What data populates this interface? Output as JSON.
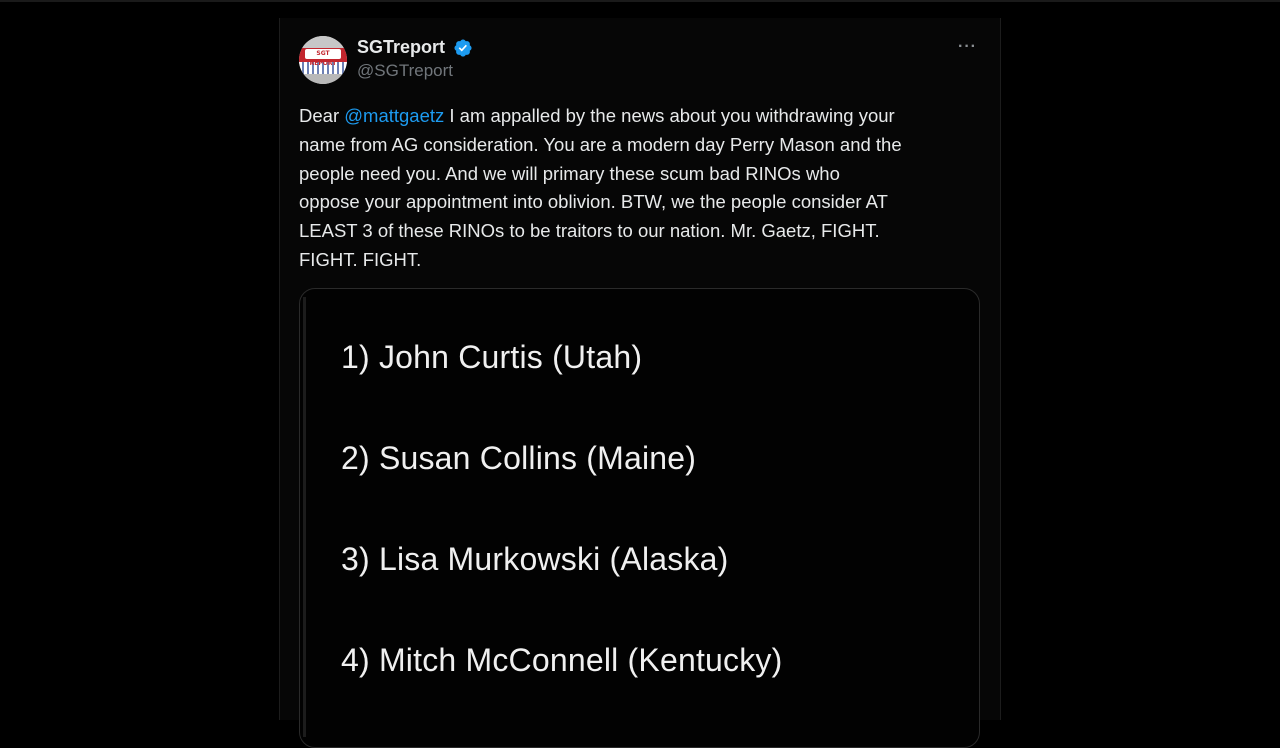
{
  "tweet": {
    "display_name": "SGTreport",
    "handle": "@SGTreport",
    "avatar_text": "SGT REPORT",
    "more_label": "···",
    "body": {
      "greeting": "Dear ",
      "mention": "@mattgaetz",
      "line1_rest": " I am appalled by the news about you withdrawing your",
      "rest": "name from AG consideration. You are a modern day Perry Mason and the\npeople need you. And we will primary these scum bad RINOs who\noppose your appointment into oblivion.  BTW, we the people consider AT\nLEAST 3 of these RINOs to be traitors to our nation. Mr. Gaetz, FIGHT.\nFIGHT. FIGHT."
    },
    "media_list": [
      "1) John Curtis (Utah)",
      "2) Susan Collins (Maine)",
      "3) Lisa Murkowski (Alaska)",
      "4) Mitch McConnell (Kentucky)"
    ]
  },
  "colors": {
    "background": "#000000",
    "text": "#e7e9ea",
    "mention": "#1d9bf0",
    "secondary": "#71767b",
    "verified": "#1d9bf0"
  }
}
